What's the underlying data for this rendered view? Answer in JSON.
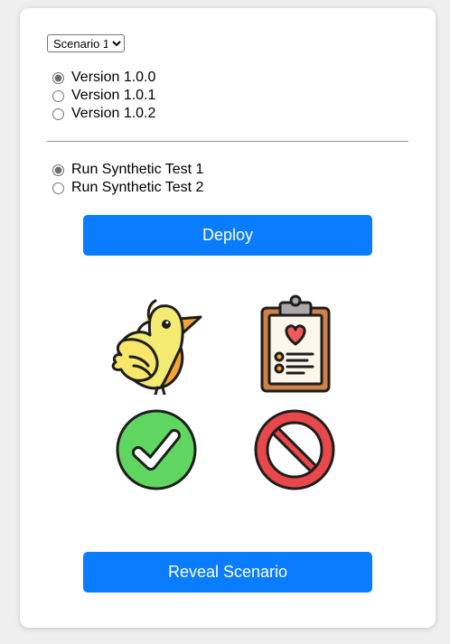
{
  "scenario_select": {
    "selected": "Scenario 1",
    "options": [
      "Scenario 1"
    ]
  },
  "versions": [
    {
      "label": "Version 1.0.0",
      "checked": true
    },
    {
      "label": "Version 1.0.1",
      "checked": false
    },
    {
      "label": "Version 1.0.2",
      "checked": false
    }
  ],
  "tests": [
    {
      "label": "Run Synthetic Test 1",
      "checked": true
    },
    {
      "label": "Run Synthetic Test 2",
      "checked": false
    }
  ],
  "buttons": {
    "deploy": "Deploy",
    "reveal": "Reveal Scenario"
  },
  "icons": {
    "canary": "canary-bird-icon",
    "checklist": "clipboard-checklist-icon",
    "success": "check-circle-icon",
    "blocked": "prohibited-icon"
  },
  "colors": {
    "accent": "#0a7cff",
    "success": "#5fd65f",
    "blocked": "#e8484a"
  }
}
